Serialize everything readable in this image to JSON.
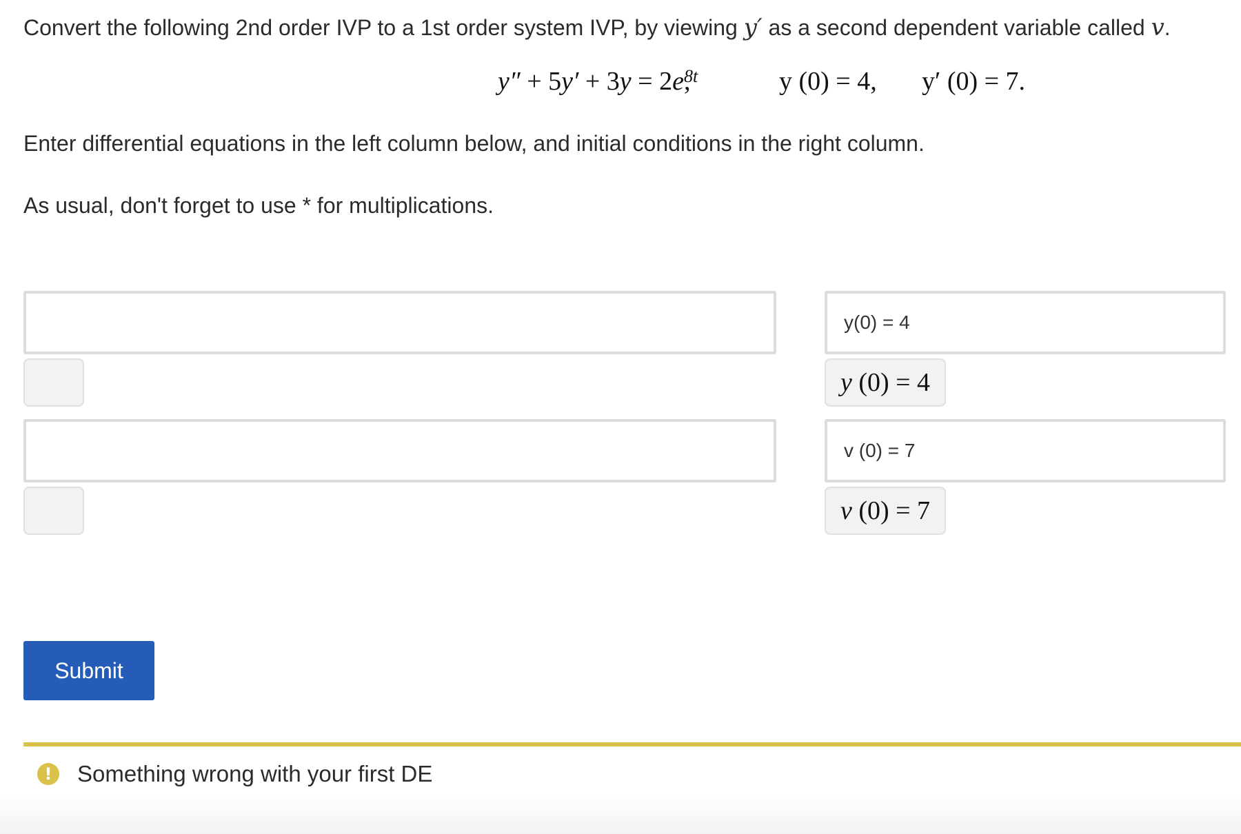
{
  "question": {
    "prompt_before": "Convert the following 2nd order IVP to a 1st order system IVP, by viewing ",
    "prompt_var_yprime": "y′",
    "prompt_after": " as a second dependent variable called ",
    "prompt_var_v": "v",
    "prompt_end": ".",
    "instructions_1": "Enter differential equations in the left column below, and initial conditions in the right column.",
    "instructions_2": "As usual, don't forget to use * for multiplications.",
    "equation": {
      "lhs_y2": "y″",
      "lhs_plus1": " + 5",
      "lhs_y1": "y′",
      "lhs_plus2": " + 3",
      "lhs_y0": "y",
      "rhs_coef": " = 2",
      "rhs_e": "e",
      "rhs_exp": "8t",
      "rhs_comma": ",",
      "ic1": "y (0) = 4,",
      "ic2": "y′ (0) = 7."
    }
  },
  "answers": {
    "de_1": {
      "value": "",
      "preview": ""
    },
    "de_2": {
      "value": "",
      "preview": ""
    },
    "ic_1": {
      "value": "y(0) = 4",
      "preview_var": "y",
      "preview_rest": " (0) = 4"
    },
    "ic_2": {
      "value": "v (0) = 7",
      "preview_var": "v",
      "preview_rest": " (0) = 7"
    }
  },
  "submit_label": "Submit",
  "feedback": {
    "icon": "warning-icon",
    "icon_glyph": "!",
    "message": "Something wrong with your first DE",
    "color": "#d9c14a"
  },
  "colors": {
    "submit_button": "#245cb8",
    "input_border": "#dcdcdc",
    "preview_background": "#f2f2f2"
  }
}
